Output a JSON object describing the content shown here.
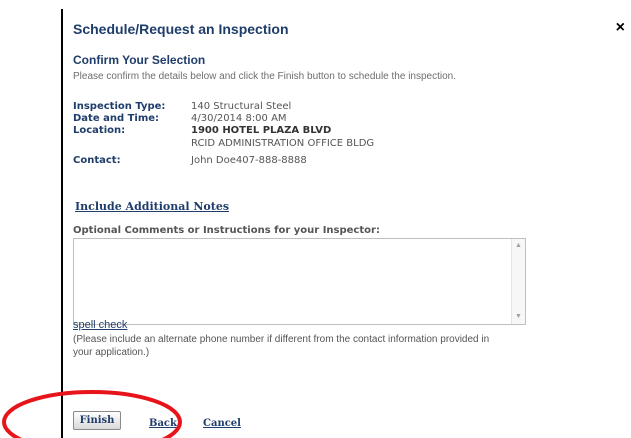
{
  "dialog": {
    "title": "Schedule/Request an Inspection",
    "close_label": "×"
  },
  "confirm": {
    "heading": "Confirm Your Selection",
    "instructions": "Please confirm the details below and click the Finish button to schedule the inspection."
  },
  "details": {
    "inspection_type_label": "Inspection Type:",
    "inspection_type_value": "140 Structural Steel",
    "date_time_label": "Date and Time:",
    "date_time_value": "4/30/2014 8:00 AM",
    "location_label": "Location:",
    "location_line1": "1900 HOTEL PLAZA BLVD",
    "location_line2": "RCID ADMINISTRATION OFFICE BLDG",
    "contact_label": "Contact:",
    "contact_value": "John Doe407-888-8888"
  },
  "notes": {
    "link_label": "Include Additional Notes",
    "comments_label": "Optional Comments or Instructions for your Inspector:",
    "comments_value": ""
  },
  "spell_check_label": "spell check",
  "phone_note": "(Please include an alternate phone number if different from the contact information provided in your application.)",
  "actions": {
    "finish_label": "Finish",
    "back_label": "Back",
    "cancel_label": "Cancel"
  },
  "colors": {
    "heading_blue": "#1f3d6b",
    "highlight_red": "#e8141c"
  }
}
